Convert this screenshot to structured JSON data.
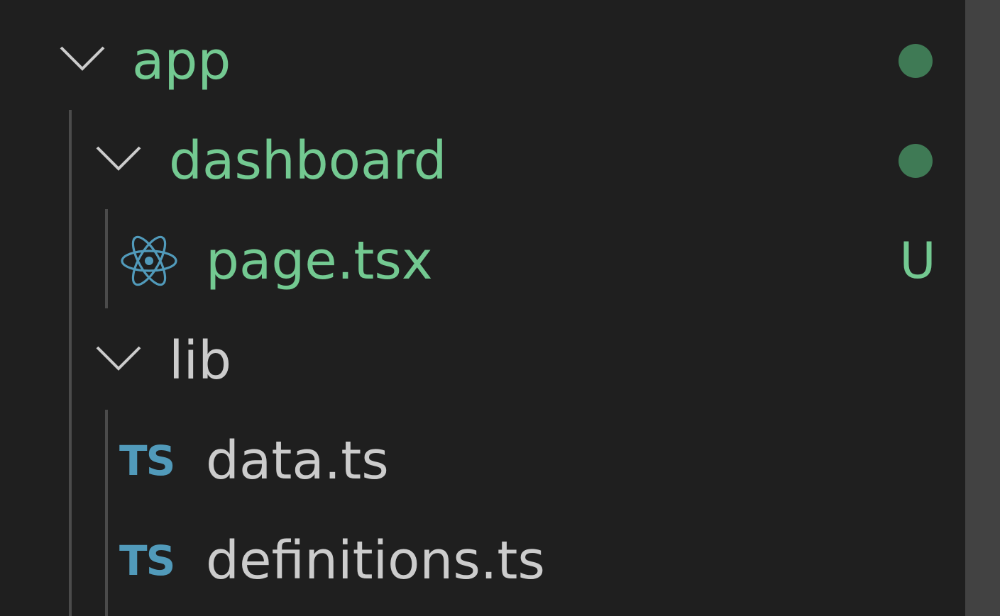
{
  "tree": {
    "items": [
      {
        "name": "app",
        "status": "modified-dot",
        "expanded": true,
        "color": "#73c991"
      },
      {
        "name": "dashboard",
        "status": "modified-dot",
        "expanded": true,
        "color": "#73c991"
      },
      {
        "name": "page.tsx",
        "icon": "react-icon",
        "badge": "U",
        "color": "#73c991"
      },
      {
        "name": "lib",
        "expanded": true,
        "color": "#cccccc"
      },
      {
        "name": "data.ts",
        "icon": "typescript-icon",
        "icon_text": "TS",
        "color": "#cccccc"
      },
      {
        "name": "definitions.ts",
        "icon": "typescript-icon",
        "icon_text": "TS",
        "color": "#cccccc"
      }
    ]
  },
  "colors": {
    "background": "#1f1f1f",
    "untracked_green": "#73c991",
    "status_dot": "#3f7a55",
    "ts_icon_blue": "#519aba",
    "react_icon_blue": "#519aba",
    "default_text": "#cccccc",
    "scrollbar": "#424242"
  }
}
